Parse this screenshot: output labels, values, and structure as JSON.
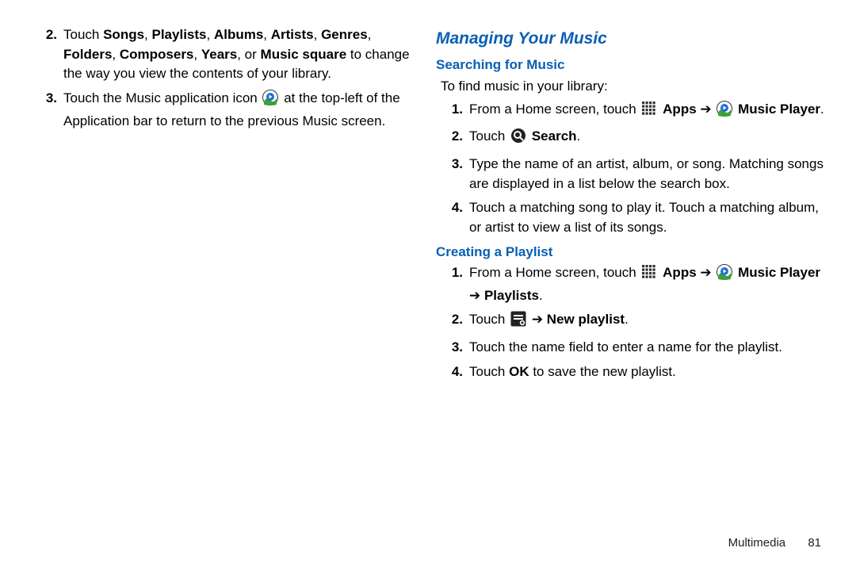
{
  "left": {
    "items": [
      {
        "num": "2.",
        "parts": [
          {
            "t": "Touch "
          },
          {
            "t": "Songs",
            "b": true
          },
          {
            "t": ", "
          },
          {
            "t": "Playlists",
            "b": true
          },
          {
            "t": ", "
          },
          {
            "t": "Albums",
            "b": true
          },
          {
            "t": ", "
          },
          {
            "t": "Artists",
            "b": true
          },
          {
            "t": ", "
          },
          {
            "t": "Genres",
            "b": true
          },
          {
            "t": ", "
          },
          {
            "t": "Folders",
            "b": true
          },
          {
            "t": ", "
          },
          {
            "t": "Composers",
            "b": true
          },
          {
            "t": ", "
          },
          {
            "t": "Years",
            "b": true
          },
          {
            "t": ", or "
          },
          {
            "t": "Music square",
            "b": true
          },
          {
            "t": " to change the way you view the contents of your library."
          }
        ]
      },
      {
        "num": "3.",
        "parts": [
          {
            "t": "Touch the Music application icon "
          },
          {
            "icon": "music"
          },
          {
            "t": " at the top-left of the Application bar to return to the previous Music screen."
          }
        ]
      }
    ]
  },
  "right": {
    "heading": "Managing Your Music",
    "sections": [
      {
        "title": "Searching for Music",
        "intro": "To find music in your library:",
        "items": [
          {
            "num": "1.",
            "parts": [
              {
                "t": "From a Home screen, touch "
              },
              {
                "icon": "apps"
              },
              {
                "t": " "
              },
              {
                "t": "Apps",
                "b": true
              },
              {
                "t": " ➔ "
              },
              {
                "icon": "music"
              },
              {
                "t": " "
              },
              {
                "t": "Music Player",
                "b": true
              },
              {
                "t": "."
              }
            ]
          },
          {
            "num": "2.",
            "parts": [
              {
                "t": "Touch "
              },
              {
                "icon": "search"
              },
              {
                "t": " "
              },
              {
                "t": "Search",
                "b": true
              },
              {
                "t": "."
              }
            ]
          },
          {
            "num": "3.",
            "parts": [
              {
                "t": "Type the name of an artist, album, or song. Matching songs are displayed in a list below the search box."
              }
            ]
          },
          {
            "num": "4.",
            "parts": [
              {
                "t": "Touch a matching song to play it. Touch a matching album, or artist to view a list of its songs."
              }
            ]
          }
        ]
      },
      {
        "title": "Creating a Playlist",
        "items": [
          {
            "num": "1.",
            "parts": [
              {
                "t": "From a Home screen, touch "
              },
              {
                "icon": "apps"
              },
              {
                "t": " "
              },
              {
                "t": "Apps",
                "b": true
              },
              {
                "t": " ➔ "
              },
              {
                "icon": "music"
              },
              {
                "t": " "
              },
              {
                "t": "Music Player",
                "b": true
              },
              {
                "t": " ➔ "
              },
              {
                "t": "Playlists",
                "b": true
              },
              {
                "t": "."
              }
            ]
          },
          {
            "num": "2.",
            "parts": [
              {
                "t": "Touch "
              },
              {
                "icon": "menu"
              },
              {
                "t": " ➔ "
              },
              {
                "t": "New playlist",
                "b": true
              },
              {
                "t": "."
              }
            ]
          },
          {
            "num": "3.",
            "parts": [
              {
                "t": "Touch the name field to enter a name for the playlist."
              }
            ]
          },
          {
            "num": "4.",
            "parts": [
              {
                "t": "Touch "
              },
              {
                "t": "OK",
                "b": true
              },
              {
                "t": " to save the new playlist."
              }
            ]
          }
        ]
      }
    ]
  },
  "footer": {
    "section": "Multimedia",
    "page": "81"
  }
}
